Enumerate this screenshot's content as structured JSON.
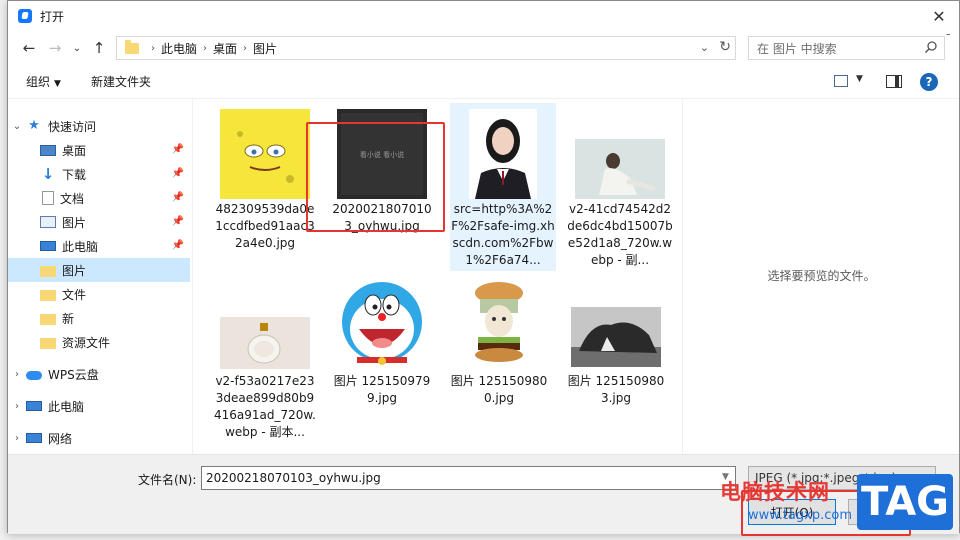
{
  "window": {
    "title": "打开"
  },
  "nav": {
    "breadcrumb": [
      "此电脑",
      "桌面",
      "图片"
    ],
    "search_placeholder": "在 图片 中搜索"
  },
  "toolbar": {
    "organize": "组织",
    "new_folder": "新建文件夹"
  },
  "sidebar": {
    "items": [
      {
        "label": "快速访问",
        "icon": "star-icon",
        "pinned": false
      },
      {
        "label": "桌面",
        "icon": "desktop-icon",
        "pinned": true
      },
      {
        "label": "下载",
        "icon": "download-icon",
        "pinned": true
      },
      {
        "label": "文档",
        "icon": "document-icon",
        "pinned": true
      },
      {
        "label": "图片",
        "icon": "pictures-icon",
        "pinned": true
      },
      {
        "label": "此电脑",
        "icon": "computer-icon",
        "pinned": true
      },
      {
        "label": "图片",
        "icon": "folder-icon",
        "selected": true
      },
      {
        "label": "文件",
        "icon": "folder-icon"
      },
      {
        "label": "新",
        "icon": "folder-icon"
      },
      {
        "label": "资源文件",
        "icon": "folder-icon"
      },
      {
        "label": "WPS云盘",
        "icon": "cloud-icon"
      },
      {
        "label": "此电脑",
        "icon": "computer-icon"
      },
      {
        "label": "网络",
        "icon": "network-icon"
      }
    ]
  },
  "files": [
    {
      "name": "482309539da0e1ccdfbed91aac32a4e0.jpg",
      "thumb": "spongebob"
    },
    {
      "name": "20200218070103_oyhwu.jpg",
      "thumb": "dark"
    },
    {
      "name": "src=http%3A%2F%2Fsafe-img.xhscdn.com%2Fbw1%2F6a74...",
      "thumb": "portrait",
      "selected": true
    },
    {
      "name": "v2-41cd74542d2de6dc4bd15007be52d1a8_720w.webp - 副...",
      "thumb": "woman"
    },
    {
      "name": "v2-f53a0217e233deae899d80b9416a91ad_720w.webp - 副本...",
      "thumb": "bottle"
    },
    {
      "name": "图片 1251509799.jpg",
      "thumb": "doraemon"
    },
    {
      "name": "图片 1251509800.jpg",
      "thumb": "burger"
    },
    {
      "name": "图片 1251509803.jpg",
      "thumb": "rock"
    }
  ],
  "preview": {
    "message": "选择要预览的文件。"
  },
  "bottom": {
    "filename_label": "文件名(N):",
    "filename_value": "20200218070103_oyhwu.jpg",
    "filter": "JPEG (*.jpg;*.jpeg;*.jpe)",
    "open": "打开(O)",
    "cancel": "取消"
  },
  "dark_thumb_text": "看小说 看小说",
  "watermark": {
    "text": "电脑技术网",
    "url": "www.tagxp.com",
    "badge": "TAG"
  },
  "colors": {
    "accent": "#0078d7",
    "highlight": "#e8332f",
    "selection": "#cce8ff"
  }
}
